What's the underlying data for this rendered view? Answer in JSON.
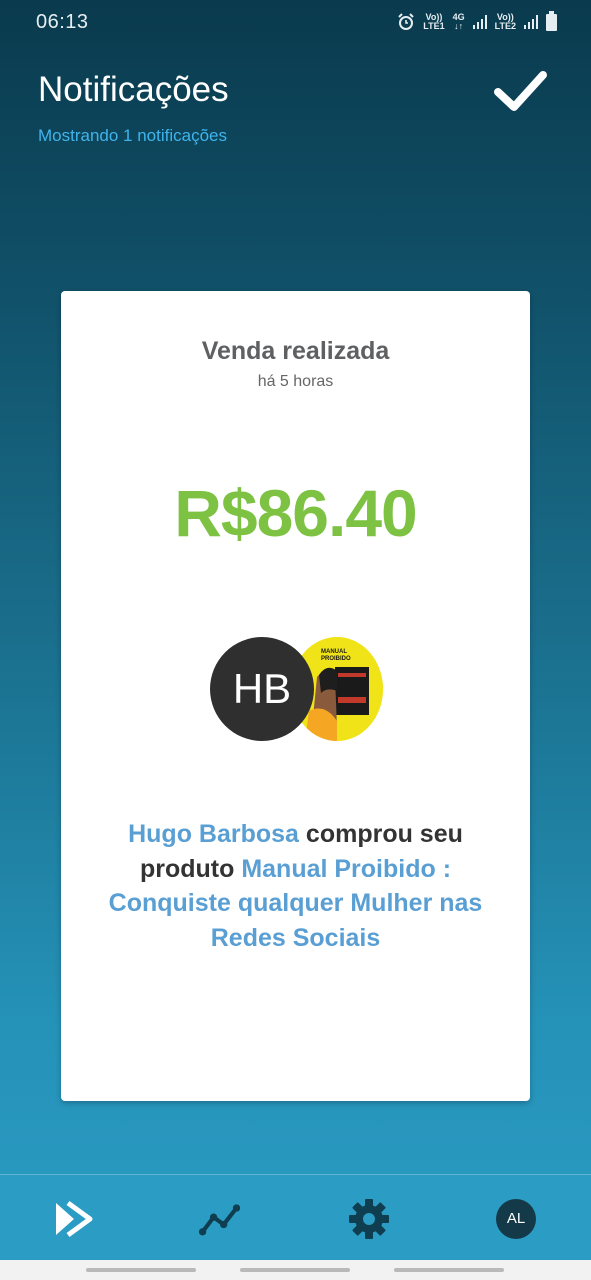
{
  "status_bar": {
    "time": "06:13",
    "net1_top": "Vo))",
    "net1_bottom": "LTE1",
    "net_type": "4G",
    "net_arrows": "↓↑",
    "net2_top": "Vo))",
    "net2_bottom": "LTE2"
  },
  "header": {
    "title": "Notificações",
    "subtitle": "Mostrando 1 notificações"
  },
  "notification": {
    "title": "Venda realizada",
    "time": "há 5 horas",
    "amount": "R$86.40",
    "buyer_initials": "HB",
    "buyer_name": "Hugo Barbosa",
    "text_1": " comprou seu",
    "text_2": "produto ",
    "product_name": "Manual Proibido : Conquiste qualquer Mulher nas Redes Sociais",
    "product_image_text": "MANUAL PROIBIDO"
  },
  "bottom_nav": {
    "items": [
      {
        "icon": "play-forward-icon"
      },
      {
        "icon": "chart-line-icon"
      },
      {
        "icon": "gear-icon"
      },
      {
        "icon": "avatar",
        "label": "AL"
      }
    ]
  },
  "colors": {
    "amount": "#7dc242",
    "link": "#5a9fd4",
    "subtitle": "#3fb4ec",
    "nav_bg": "#2b9cc4"
  }
}
